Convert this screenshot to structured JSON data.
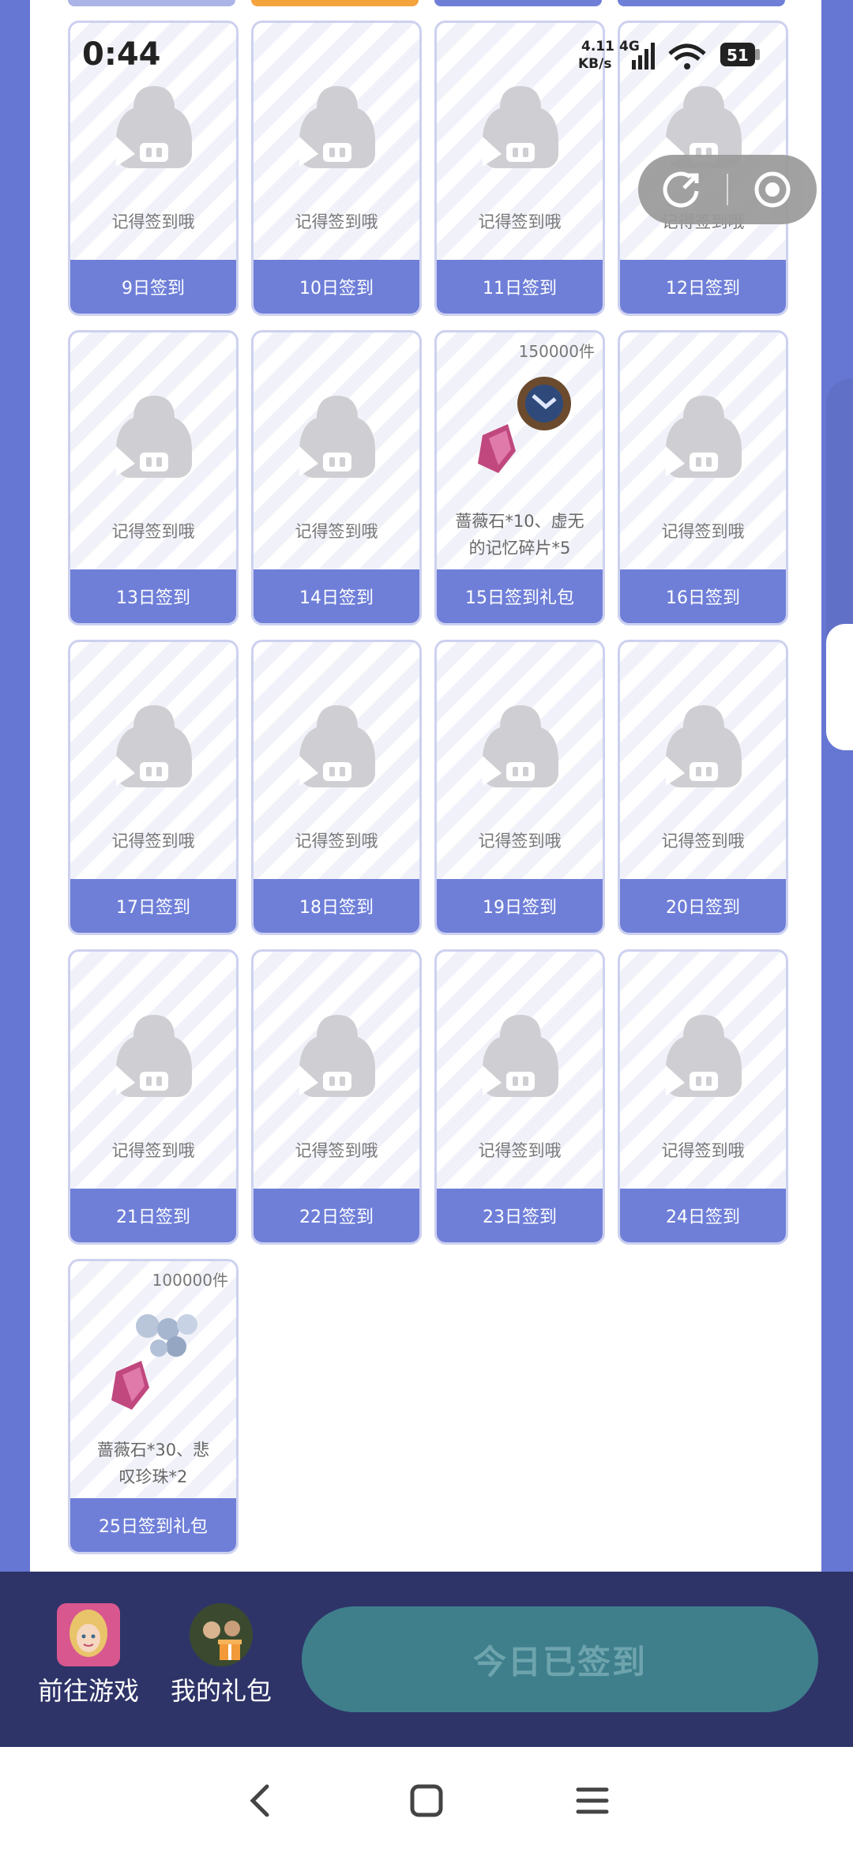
{
  "status_bar": {
    "time": "0:44",
    "net_speed_value": "4.11",
    "net_speed_unit": "KB/s",
    "network": "4G",
    "battery": "51"
  },
  "cards": [
    {
      "day_label": "9日签到",
      "hint": "记得签到哦",
      "type": "empty"
    },
    {
      "day_label": "10日签到",
      "hint": "记得签到哦",
      "type": "empty"
    },
    {
      "day_label": "11日签到",
      "hint": "记得签到哦",
      "type": "empty"
    },
    {
      "day_label": "12日签到",
      "hint": "记得签到哦",
      "type": "empty"
    },
    {
      "day_label": "13日签到",
      "hint": "记得签到哦",
      "type": "empty"
    },
    {
      "day_label": "14日签到",
      "hint": "记得签到哦",
      "type": "empty"
    },
    {
      "day_label": "15日签到礼包",
      "count": "150000件",
      "reward_line1": "蔷薇石*10、虚无",
      "reward_line2": "的记忆碎片*5",
      "type": "gift"
    },
    {
      "day_label": "16日签到",
      "hint": "记得签到哦",
      "type": "empty"
    },
    {
      "day_label": "17日签到",
      "hint": "记得签到哦",
      "type": "empty"
    },
    {
      "day_label": "18日签到",
      "hint": "记得签到哦",
      "type": "empty"
    },
    {
      "day_label": "19日签到",
      "hint": "记得签到哦",
      "type": "empty"
    },
    {
      "day_label": "20日签到",
      "hint": "记得签到哦",
      "type": "empty"
    },
    {
      "day_label": "21日签到",
      "hint": "记得签到哦",
      "type": "empty"
    },
    {
      "day_label": "22日签到",
      "hint": "记得签到哦",
      "type": "empty"
    },
    {
      "day_label": "23日签到",
      "hint": "记得签到哦",
      "type": "empty"
    },
    {
      "day_label": "24日签到",
      "hint": "记得签到哦",
      "type": "empty"
    },
    {
      "day_label": "25日签到礼包",
      "count": "100000件",
      "reward_line1": "蔷薇石*30、悲",
      "reward_line2": "叹珍珠*2",
      "type": "gift"
    }
  ],
  "bottom_bar": {
    "go_game_label": "前往游戏",
    "my_gifts_label": "我的礼包",
    "signed_button_label": "今日已签到"
  },
  "colors": {
    "background": "#6676d3",
    "card_footer": "#6f7fd8",
    "bottom_bar": "#2e3468",
    "signed_button": "#3f7f8c"
  }
}
